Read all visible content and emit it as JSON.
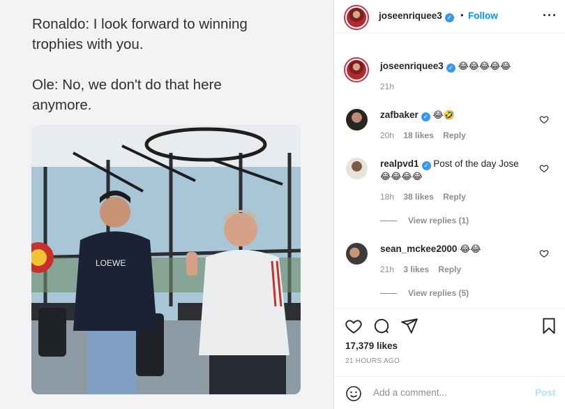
{
  "post": {
    "caption": "Ronaldo: I look forward to winning\ntrophies with you.\n\nOle: No, we don't do that here\nanymore.",
    "shirt_text": "LOEWE"
  },
  "header": {
    "username": "joseenriquee3",
    "separator": "•",
    "follow_label": "Follow",
    "more_label": "···"
  },
  "owner_comment": {
    "username": "joseenriquee3",
    "text": "😂😂😂😂😂",
    "time": "21h"
  },
  "comments": [
    {
      "username": "zafbaker",
      "verified": true,
      "text": "😂🤣",
      "time": "20h",
      "likes": "18 likes",
      "reply": "Reply"
    },
    {
      "username": "realpvd1",
      "verified": true,
      "text": "Post of the day Jose",
      "text2": "😂😂😂😂",
      "time": "18h",
      "likes": "38 likes",
      "reply": "Reply",
      "view_replies": "View replies (1)"
    },
    {
      "username": "sean_mckee2000",
      "verified": false,
      "text": "😂😂",
      "time": "21h",
      "likes": "3 likes",
      "reply": "Reply",
      "view_replies": "View replies (5)"
    }
  ],
  "actions": {
    "likes": "17,379 likes",
    "time": "21 HOURS AGO"
  },
  "add_comment": {
    "placeholder": "Add a comment...",
    "post_label": "Post"
  },
  "colors": {
    "accent": "#0095f6",
    "verified": "#3897f0",
    "muted": "#8e8e8e",
    "post_disabled": "#b2dffc"
  }
}
